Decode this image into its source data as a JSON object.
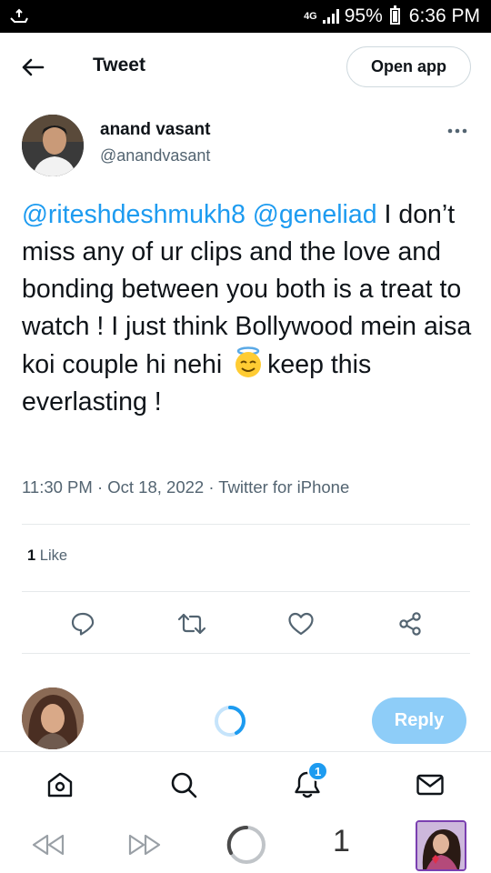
{
  "status_bar": {
    "network": "4G",
    "battery_percent": "95%",
    "time": "6:36 PM",
    "icons": [
      "notification-icon",
      "signal-icon",
      "battery-icon"
    ]
  },
  "header": {
    "title": "Tweet",
    "open_app_label": "Open app",
    "back_icon": "back-arrow-icon"
  },
  "tweet": {
    "author_name": "anand vasant",
    "author_handle": "@anandvasant",
    "mention_1": "@riteshdeshmukh8",
    "mention_2": "@geneliad",
    "text_part_1": " I don’t miss any of ur clips and the love and bonding between you both is a treat to watch ! I just think Bollywood mein aisa koi couple hi nehi ",
    "emoji": "smiling-face-with-halo-emoji",
    "text_part_2": "keep this everlasting !",
    "meta": "11:30 PM · Oct 18, 2022 · Twitter for iPhone",
    "like_count": "1",
    "like_label": " Like"
  },
  "actions": [
    "reply-icon",
    "retweet-icon",
    "like-icon",
    "share-icon"
  ],
  "reply_bar": {
    "reply_label": "Reply"
  },
  "bottom_nav": {
    "items": [
      "home-icon",
      "search-icon",
      "notifications-icon",
      "messages-icon"
    ],
    "notification_badge": "1"
  },
  "browser_bar": {
    "tab_count": "1"
  },
  "colors": {
    "accent": "#1d9bf0",
    "reply_button_disabled": "#8ecdf8",
    "secondary_text": "#536471"
  }
}
